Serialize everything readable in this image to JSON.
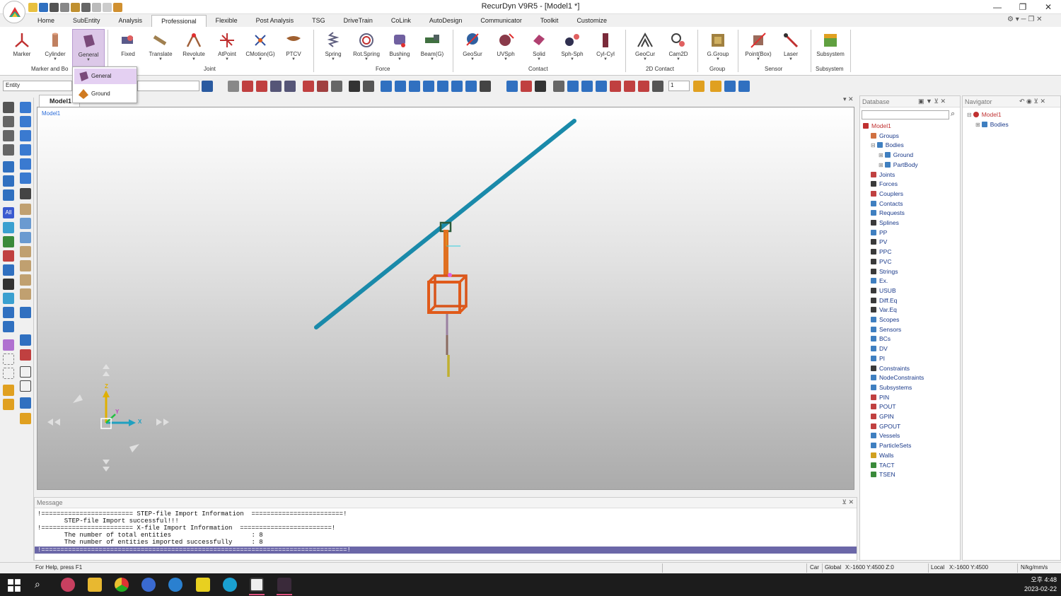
{
  "app": {
    "title": "RecurDyn V9R5  - [Model1 *]",
    "window_controls": [
      "—",
      "❐",
      "✕"
    ]
  },
  "menu_tabs": [
    "Home",
    "SubEntity",
    "Analysis",
    "Professional",
    "Flexible",
    "Post Analysis",
    "TSG",
    "DriveTrain",
    "CoLink",
    "AutoDesign",
    "Communicator",
    "Toolkit",
    "Customize"
  ],
  "active_tab": "Professional",
  "ribbon": {
    "buttons": [
      {
        "label": "Marker",
        "icon": "marker-icon"
      },
      {
        "label": "Cylinder",
        "icon": "cylinder-icon"
      },
      {
        "label": "General",
        "icon": "general-body-icon"
      },
      {
        "label": "Fixed",
        "icon": "fixed-joint-icon"
      },
      {
        "label": "Translate",
        "icon": "translate-joint-icon"
      },
      {
        "label": "Revolute",
        "icon": "revolute-joint-icon"
      },
      {
        "label": "AtPoint",
        "icon": "atpoint-joint-icon"
      },
      {
        "label": "CMotion(G)",
        "icon": "cmotion-icon"
      },
      {
        "label": "PTCV",
        "icon": "ptcv-icon"
      },
      {
        "label": "Spring",
        "icon": "spring-icon"
      },
      {
        "label": "Rot.Spring",
        "icon": "rot-spring-icon"
      },
      {
        "label": "Bushing",
        "icon": "bushing-icon"
      },
      {
        "label": "Beam(G)",
        "icon": "beam-icon"
      },
      {
        "label": "GeoSur",
        "icon": "geosur-icon"
      },
      {
        "label": "UVSph",
        "icon": "uvsph-icon"
      },
      {
        "label": "Solid",
        "icon": "solid-contact-icon"
      },
      {
        "label": "Sph-Sph",
        "icon": "sph-sph-icon"
      },
      {
        "label": "Cyl-Cyl",
        "icon": "cyl-cyl-icon"
      },
      {
        "label": "GeoCur",
        "icon": "geocur-icon"
      },
      {
        "label": "Cam2D",
        "icon": "cam2d-icon"
      },
      {
        "label": "G.Group",
        "icon": "group-icon"
      },
      {
        "label": "Point(Box)",
        "icon": "point-box-sensor-icon"
      },
      {
        "label": "Laser",
        "icon": "laser-sensor-icon"
      },
      {
        "label": "Subsystem",
        "icon": "subsystem-icon"
      }
    ],
    "groups": [
      "Marker and Bo",
      "Joint",
      "Force",
      "Contact",
      "2D Contact",
      "Group",
      "Sensor",
      "Subsystem"
    ]
  },
  "dropdown": {
    "items": [
      "General",
      "Ground"
    ]
  },
  "toolbar": {
    "entity_value": "Entity",
    "page_value": "1"
  },
  "document": {
    "tab": "Model1",
    "viewport_label": "Model1"
  },
  "axes": {
    "x": "X",
    "y": "Y",
    "z": "Z"
  },
  "database": {
    "title": "Database",
    "tree": [
      {
        "label": "Model1",
        "indent": 0,
        "color": "#c03030"
      },
      {
        "label": "Groups",
        "indent": 1,
        "color": "#d07040"
      },
      {
        "label": "Bodies",
        "indent": 1,
        "color": "#3f7fc0"
      },
      {
        "label": "Ground",
        "indent": 2,
        "color": "#3f7fc0"
      },
      {
        "label": "PartBody",
        "indent": 2,
        "color": "#3f7fc0"
      },
      {
        "label": "Joints",
        "indent": 1,
        "color": "#c04040"
      },
      {
        "label": "Forces",
        "indent": 1,
        "color": "#3a3a3a"
      },
      {
        "label": "Couplers",
        "indent": 1,
        "color": "#c04040"
      },
      {
        "label": "Contacts",
        "indent": 1,
        "color": "#3f7fc0"
      },
      {
        "label": "Requests",
        "indent": 1,
        "color": "#3f7fc0"
      },
      {
        "label": "Splines",
        "indent": 1,
        "color": "#3a3a3a"
      },
      {
        "label": "PP",
        "indent": 1,
        "color": "#3f7fc0"
      },
      {
        "label": "PV",
        "indent": 1,
        "color": "#3a3a3a"
      },
      {
        "label": "PPC",
        "indent": 1,
        "color": "#3a3a3a"
      },
      {
        "label": "PVC",
        "indent": 1,
        "color": "#3a3a3a"
      },
      {
        "label": "Strings",
        "indent": 1,
        "color": "#3a3a3a"
      },
      {
        "label": "Ex.",
        "indent": 1,
        "color": "#3f7fc0"
      },
      {
        "label": "USUB",
        "indent": 1,
        "color": "#3a3a3a"
      },
      {
        "label": "Diff.Eq",
        "indent": 1,
        "color": "#3a3a3a"
      },
      {
        "label": "Var.Eq",
        "indent": 1,
        "color": "#3a3a3a"
      },
      {
        "label": "Scopes",
        "indent": 1,
        "color": "#3f7fc0"
      },
      {
        "label": "Sensors",
        "indent": 1,
        "color": "#3f7fc0"
      },
      {
        "label": "BCs",
        "indent": 1,
        "color": "#3f7fc0"
      },
      {
        "label": "DV",
        "indent": 1,
        "color": "#3f7fc0"
      },
      {
        "label": "PI",
        "indent": 1,
        "color": "#3f7fc0"
      },
      {
        "label": "Constraints",
        "indent": 1,
        "color": "#3a3a3a"
      },
      {
        "label": "NodeConstraints",
        "indent": 1,
        "color": "#3f7fc0"
      },
      {
        "label": "Subsystems",
        "indent": 1,
        "color": "#3f7fc0"
      },
      {
        "label": "PIN",
        "indent": 1,
        "color": "#c04040"
      },
      {
        "label": "POUT",
        "indent": 1,
        "color": "#c04040"
      },
      {
        "label": "GPIN",
        "indent": 1,
        "color": "#c04040"
      },
      {
        "label": "GPOUT",
        "indent": 1,
        "color": "#c04040"
      },
      {
        "label": "Vessels",
        "indent": 1,
        "color": "#3f7fc0"
      },
      {
        "label": "ParticleSets",
        "indent": 1,
        "color": "#3f7fc0"
      },
      {
        "label": "Walls",
        "indent": 1,
        "color": "#d0a020"
      },
      {
        "label": "TACT",
        "indent": 1,
        "color": "#3a8a3a"
      },
      {
        "label": "TSEN",
        "indent": 1,
        "color": "#3a8a3a"
      }
    ]
  },
  "navigator": {
    "title": "Navigator",
    "tree": [
      {
        "label": "Model1",
        "color": "#c03030"
      },
      {
        "label": "Bodies",
        "color": "#3f7fc0"
      }
    ]
  },
  "message": {
    "title": "Message",
    "lines": [
      "!======================== STEP-file Import Information  ========================!",
      "       STEP-file Import successful!!!",
      "!======================== X-file Import Information  ========================!",
      "       The number of total entities                     : 8",
      "       The number of entities imported successfully     : 8",
      "!================================================================================!"
    ]
  },
  "status": {
    "help": "For Help, press F1",
    "coord_system": "Car",
    "global_label": "Global",
    "global_coords": "X:-1600 Y:4500 Z:0",
    "local_label": "Local",
    "local_coords": "X:-1600 Y:4500",
    "units": "N/kg/mm/s"
  },
  "taskbar": {
    "time": "오후 4:48",
    "date": "2023-02-22"
  },
  "colors": {
    "beam": "#1a8aaa",
    "frame": "#e05a1a",
    "selected_tab": "#dcc8e8",
    "message_highlight": "#6b67a8"
  }
}
